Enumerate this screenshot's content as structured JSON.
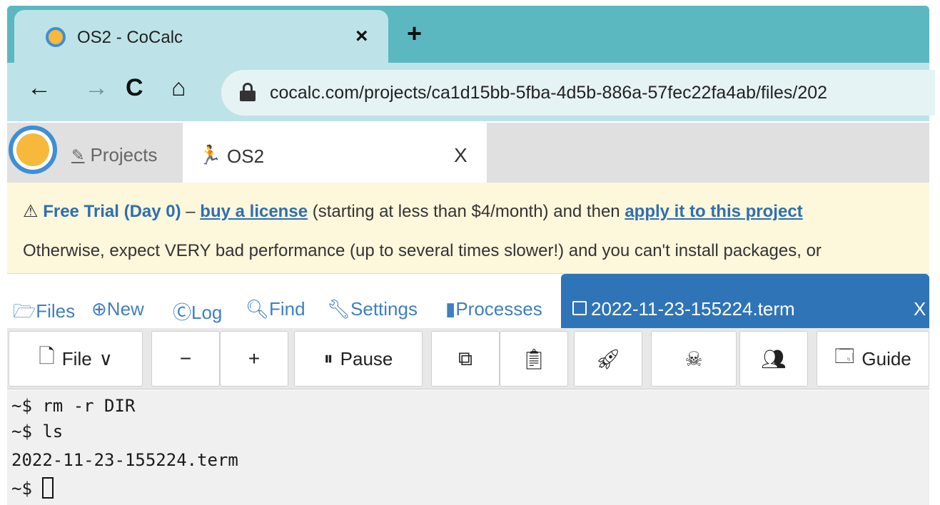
{
  "browser": {
    "tab_title": "OS2 - CoCalc",
    "tab_close": "×",
    "new_tab": "+",
    "url": "cocalc.com/projects/ca1d15bb-5fba-4d5b-886a-57fec22fa4ab/files/202",
    "back": "←",
    "forward": "→",
    "reload": "C",
    "home": "⌂"
  },
  "app": {
    "projects_label": "Projects",
    "project_tab_label": "OS2",
    "project_tab_close": "X"
  },
  "banner": {
    "trial_text": "Free Trial (Day 0)",
    "dash": " – ",
    "buy_link": "buy a license",
    "middle_text": " (starting at less than $4/month) and then ",
    "apply_link": "apply it to this project",
    "line2": "Otherwise, expect VERY bad performance (up to several times slower!) and you can't install packages, or"
  },
  "project_nav": {
    "files": "Files",
    "new": "New",
    "log": "Log",
    "find": "Find",
    "settings": "Settings",
    "processes": "Processes",
    "open_file": "2022-11-23-155224.term",
    "open_file_close": "X"
  },
  "toolbar": {
    "file": "File",
    "minus": "−",
    "plus": "+",
    "pause": "Pause",
    "guide": "Guide"
  },
  "terminal": {
    "lines": [
      "~$ rm -r DIR",
      "~$ ls",
      "2022-11-23-155224.term",
      "~$ "
    ]
  },
  "colors": {
    "browser_teal": "#5bb8c1",
    "cocalc_blue": "#2f74b6",
    "link_blue": "#3f7fc1",
    "banner_bg": "#fdf7dc"
  }
}
